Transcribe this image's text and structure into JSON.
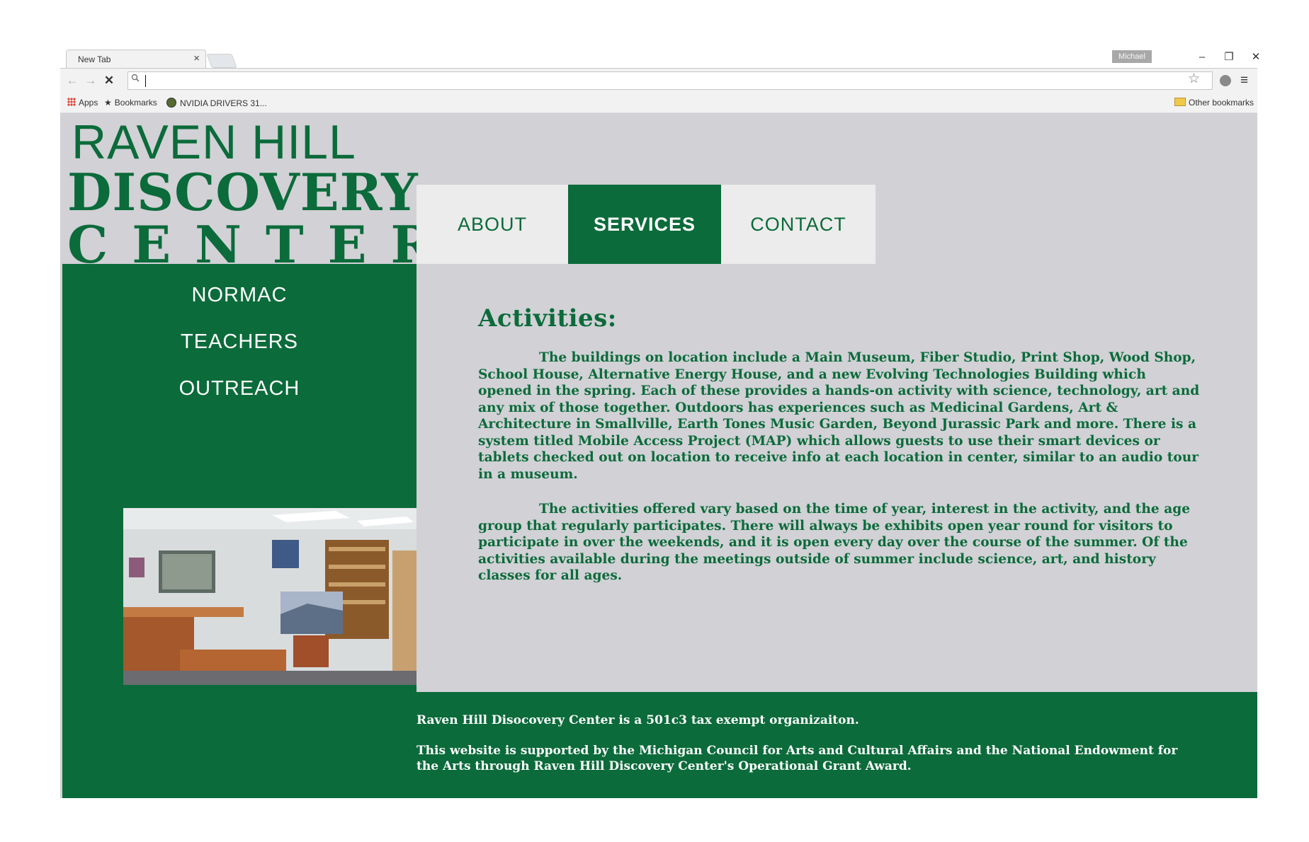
{
  "browser": {
    "tab_title": "New Tab",
    "tab_close": "×",
    "user_name": "Michael",
    "window_controls": {
      "minimize": "–",
      "restore": "❐",
      "close": "✕"
    },
    "nav": {
      "back": "←",
      "forward": "→",
      "stop": "✕"
    },
    "address_value": "",
    "star_glyph": "☆",
    "menu_glyph": "≡",
    "bookmarks": {
      "apps": "Apps",
      "bookmarks": "Bookmarks",
      "nvidia": "NVIDIA DRIVERS 31...",
      "other": "Other bookmarks"
    }
  },
  "site": {
    "logo": {
      "line1": "RAVEN HILL",
      "line2": "DISCOVERY",
      "line3": "CENTER"
    },
    "nav": [
      "ABOUT",
      "SERVICES",
      "CONTACT"
    ],
    "active_nav": "SERVICES",
    "sidebar": [
      "NORMAC",
      "TEACHERS",
      "OUTREACH"
    ],
    "content": {
      "heading": "Activities:",
      "paragraphs": [
        "The buildings on location include a Main Museum, Fiber Studio, Print Shop, Wood Shop, School House, Alternative Energy House, and a new Evolving Technologies Building which opened in the spring. Each of these provides a hands-on activity with science, technology, art and any mix of those together. Outdoors has experiences such as Medicinal Gardens, Art & Architecture in Smallville, Earth Tones Music Garden, Beyond Jurassic Park and more. There is a system titled Mobile Access Project (MAP) which allows guests to use their smart devices or tablets checked out on location to receive info at each location in center, similar to an audio tour in a museum.",
        "The activities offered vary based on the time of year, interest in the activity, and the age group that regularly participates. There will always be exhibits open year round for visitors to participate in over the weekends, and it is open every day over the course of the summer. Of the activities available during the meetings outside of summer include science, art, and history classes for all ages."
      ]
    },
    "footer": {
      "line1": "Raven Hill Disocovery Center is a 501c3 tax exempt organizaiton.",
      "line2": "This website is supported by the Michigan Council for Arts and Cultural Affairs and the National Endowment for the Arts through Raven Hill Discovery Center's Operational Grant Award."
    },
    "colors": {
      "brand_green": "#0b6b3a",
      "page_gray": "#d1d1d6",
      "nav_gray": "#ececec"
    }
  }
}
